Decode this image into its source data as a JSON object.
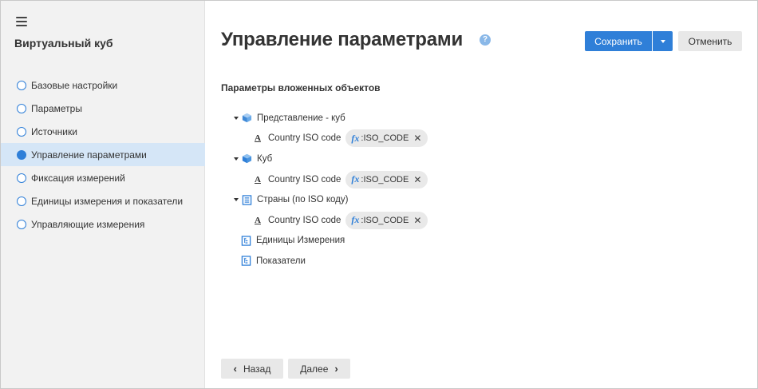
{
  "sidebar": {
    "title": "Виртуальный куб",
    "items": [
      {
        "label": "Базовые настройки",
        "active": false
      },
      {
        "label": "Параметры",
        "active": false
      },
      {
        "label": "Источники",
        "active": false
      },
      {
        "label": "Управление параметрами",
        "active": true
      },
      {
        "label": "Фиксация измерений",
        "active": false
      },
      {
        "label": "Единицы измерения и показатели",
        "active": false
      },
      {
        "label": "Управляющие измерения",
        "active": false
      }
    ]
  },
  "header": {
    "title": "Управление параметрами",
    "help": "?",
    "save_label": "Сохранить",
    "cancel_label": "Отменить"
  },
  "section": {
    "title": "Параметры вложенных объектов"
  },
  "tree": [
    {
      "label": "Представление - куб",
      "icon": "cube-view-icon",
      "child": {
        "label": "Country ISO code",
        "fx": "fx",
        "param": ":ISO_CODE"
      }
    },
    {
      "label": "Куб",
      "icon": "cube-icon",
      "child": {
        "label": "Country ISO code",
        "fx": "fx",
        "param": ":ISO_CODE"
      }
    },
    {
      "label": "Страны (по ISO коду)",
      "icon": "dictionary-icon",
      "child": {
        "label": "Country ISO code",
        "fx": "fx",
        "param": ":ISO_CODE"
      }
    },
    {
      "label": "Единицы Измерения",
      "icon": "dimension-icon"
    },
    {
      "label": "Показатели",
      "icon": "dimension-icon"
    }
  ],
  "footer": {
    "back_label": "Назад",
    "next_label": "Далее"
  },
  "colors": {
    "accent": "#2f7fd8",
    "sidebar_bg": "#f2f2f2",
    "active_item_bg": "#d5e6f7"
  }
}
